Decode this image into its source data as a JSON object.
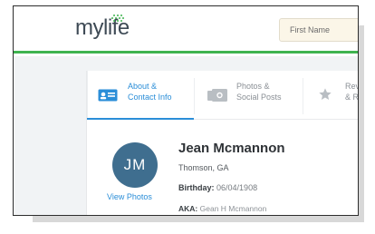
{
  "header": {
    "logo_text": "mylife",
    "search_placeholder": "First Name",
    "brand_green": "#3fb34f"
  },
  "tabs": [
    {
      "label": "About &\nContact Info",
      "icon": "id-card-icon",
      "active": true
    },
    {
      "label": "Photos &\nSocial Posts",
      "icon": "photos-icon",
      "active": false
    },
    {
      "label": "Rev\n& R",
      "icon": "star-icon",
      "active": false
    }
  ],
  "profile": {
    "initials": "JM",
    "view_photos_label": "View Photos",
    "name": "Jean Mcmannon",
    "location": "Thomson, GA",
    "birthday_label": "Birthday:",
    "birthday_value": "06/04/1908",
    "aka_label": "AKA:",
    "aka_value": "Gean H Mcmannon"
  },
  "colors": {
    "accent_blue": "#2b8ed8",
    "avatar_bg": "#3f6e8f"
  }
}
